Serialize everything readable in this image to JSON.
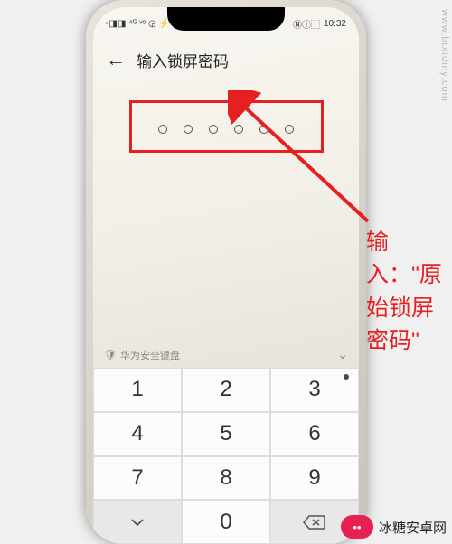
{
  "status": {
    "left_icons": "▫◨◨ ⁴ᴳ ᵛᵒ ◶ ⚡",
    "right_icons": "ⓃⒾ⬚",
    "time": "10:32"
  },
  "header": {
    "title": "输入锁屏密码"
  },
  "pin": {
    "digit_count": 6
  },
  "keyboard": {
    "label": "华为安全键盘",
    "keys": [
      "1",
      "2",
      "3",
      "4",
      "5",
      "6",
      "7",
      "8",
      "9",
      "",
      "0",
      ""
    ]
  },
  "annotation": {
    "side_text": "输入：\"原始锁屏密码\""
  },
  "watermark": "www.btxtdmy.com",
  "brand": {
    "logo_glyph": "••",
    "text": "冰糖安卓网"
  }
}
